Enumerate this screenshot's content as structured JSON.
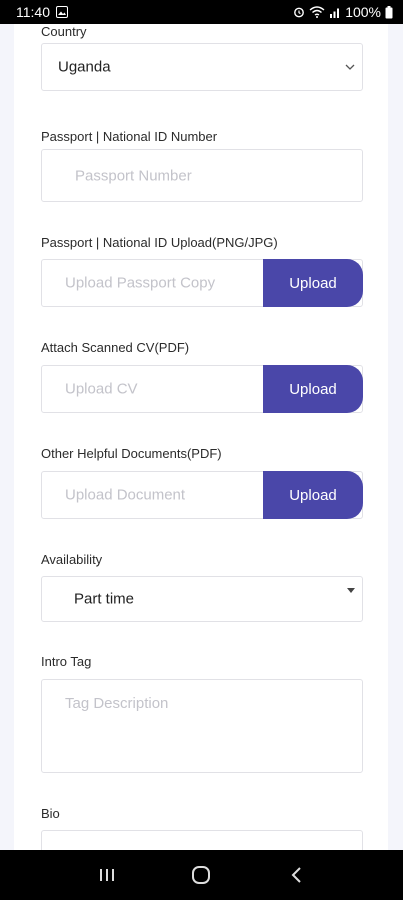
{
  "status_bar": {
    "time": "11:40",
    "battery": "100%",
    "icons": [
      "gallery-icon",
      "alarm-icon",
      "wifi-icon",
      "signal-icon",
      "battery-icon"
    ]
  },
  "form": {
    "country": {
      "label": "Country",
      "value": "Uganda"
    },
    "passport_number": {
      "label": "Passport | National ID Number",
      "placeholder": "Passport Number"
    },
    "passport_upload": {
      "label": "Passport | National ID Upload(PNG/JPG)",
      "placeholder": "Upload Passport Copy",
      "button": "Upload"
    },
    "cv_upload": {
      "label": "Attach Scanned CV(PDF)",
      "placeholder": "Upload CV",
      "button": "Upload"
    },
    "docs_upload": {
      "label": "Other Helpful Documents(PDF)",
      "placeholder": "Upload Document",
      "button": "Upload"
    },
    "availability": {
      "label": "Availability",
      "value": "Part time"
    },
    "intro_tag": {
      "label": "Intro Tag",
      "placeholder": "Tag Description"
    },
    "bio": {
      "label": "Bio"
    }
  },
  "colors": {
    "accent": "#4a47a9",
    "page_bg": "#f4f5fb",
    "border": "#e1e1e6",
    "placeholder": "#c3c3ca"
  },
  "nav_bar": {
    "icons": [
      "recent-apps-icon",
      "home-icon",
      "back-icon"
    ]
  }
}
